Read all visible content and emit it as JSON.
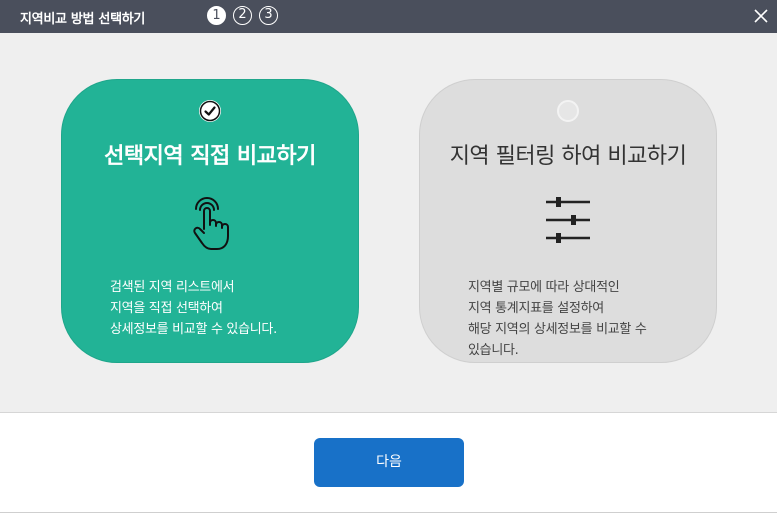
{
  "dialog": {
    "title": "지역비교 방법 선택하기",
    "steps": [
      "1",
      "2",
      "3"
    ],
    "active_step": "1"
  },
  "options": [
    {
      "title": "선택지역 직접 비교하기",
      "selected": true,
      "icon": "touch-hand-icon",
      "description": [
        "검색된 지역 리스트에서",
        "지역을 직접 선택하여",
        "상세정보를 비교할 수 있습니다."
      ]
    },
    {
      "title": "지역 필터링 하여 비교하기",
      "selected": false,
      "icon": "sliders-icon",
      "description": [
        "지역별 규모에 따라 상대적인",
        "지역 통계지표를 설정하여",
        "해당 지역의 상세정보를 비교할 수",
        "있습니다."
      ]
    }
  ],
  "footer": {
    "next_label": "다음"
  },
  "colors": {
    "titlebar": "#4a4f5c",
    "selected_card": "#22b396",
    "unselected_card": "#dddddd",
    "primary_button": "#1871c8"
  }
}
